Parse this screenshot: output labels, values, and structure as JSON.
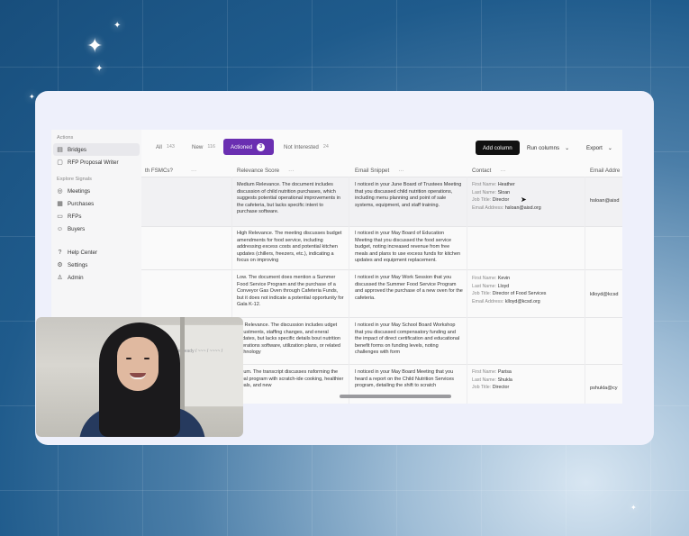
{
  "sidebar": {
    "actions_label": "Actions",
    "items_actions": [
      {
        "label": "Bridges",
        "icon": "bridge-icon",
        "active": true
      },
      {
        "label": "RFP Proposal Writer",
        "icon": "document-icon",
        "active": false
      }
    ],
    "explore_label": "Explore Signals",
    "items_explore": [
      {
        "label": "Meetings",
        "icon": "meetings-icon"
      },
      {
        "label": "Purchases",
        "icon": "cart-icon"
      },
      {
        "label": "RFPs",
        "icon": "rfp-icon"
      },
      {
        "label": "Buyers",
        "icon": "buyers-icon"
      }
    ],
    "items_bottom": [
      {
        "label": "Help Center",
        "icon": "help-icon"
      },
      {
        "label": "Settings",
        "icon": "gear-icon"
      },
      {
        "label": "Admin",
        "icon": "admin-icon"
      }
    ]
  },
  "tabs": [
    {
      "label": "All",
      "count": "143"
    },
    {
      "label": "New",
      "count": "116"
    },
    {
      "label": "Actioned",
      "count": "3"
    },
    {
      "label": "Not Interested",
      "count": "24"
    }
  ],
  "toolbar": {
    "add_column": "Add column",
    "run_columns": "Run columns",
    "export": "Export"
  },
  "columns": {
    "c0": "th FSMCs?",
    "c1": "Relevance Score",
    "c2": "Email Snippet",
    "c3": "Contact",
    "c4": "Email Addre"
  },
  "contact_keys": {
    "first": "First Name:",
    "last": "Last Name:",
    "title": "Job Title:",
    "email": "Email Address:"
  },
  "rows": [
    {
      "relevance": "Medium Relevance. The document includes discussion of child nutrition purchases, which suggests potential operational improvements in the cafeteria, but lacks specific intent to purchase software.",
      "snippet": "I noticed in your June Board of Trustees Meeting that you discussed child nutrition operations, including menu planning and point of sale systems, equipment, and staff training.",
      "first": "Heather",
      "last": "Sloan",
      "title": "Director",
      "email": "hsloan@aisd.org",
      "email_col": "hsloan@aisd"
    },
    {
      "relevance": "High Relevance. The meeting discusses budget amendments for food service, including addressing excess costs and potential kitchen updates (chillers, freezers, etc.), indicating a focus on improving",
      "snippet": "I noticed in your May Board of Education Meeting that you discussed the food service budget, noting increased revenue from free meals and plans to use excess funds for kitchen updates and equipment replacement.",
      "first": "",
      "last": "",
      "title": "",
      "email": "",
      "email_col": ""
    },
    {
      "relevance": "Low. The document does mention a Summer Food Service Program and the purchase of a Conveyor Gas Oven through Cafeteria Funds, but it does not indicate a potential opportunity for Gala K-12.",
      "snippet": "I noticed in your May Work Session that you discussed the Summer Food Service Program and approved the purchase of a new oven for the cafeteria.",
      "first": "Kevin",
      "last": "Lloyd",
      "title": "Director of Food Services",
      "email": "klloyd@kcsd.org",
      "email_col": "klloyd@kcsd"
    },
    {
      "relevance": "ow Relevance. The discussion includes udget adjustments, staffing changes, and eneral updates, but lacks specific details bout nutrition operations software, utilization plans, or related technology",
      "snippet": "I noticed in your May School Board Workshop that you discussed compensatory funding and the impact of direct certification and educational benefit forms on funding levels, noting challenges with form",
      "first": "",
      "last": "",
      "title": "",
      "email": "",
      "email_col": ""
    },
    {
      "relevance": "edium. The transcript discusses nsforming the meal program with scratch-ide cooking, healthier meals, and new",
      "snippet": "I noticed in your May Board Meeting that you heard a report on the Child Nutrition Services program, detailing the shift to scratch",
      "first": "Parisa",
      "last": "Shukla",
      "title": "Director",
      "email": "",
      "email_col": "pshukla@cy"
    }
  ],
  "video": {
    "whiteboard_text": "fall in ready / ~~~ / ~~~~ / ~~~"
  }
}
